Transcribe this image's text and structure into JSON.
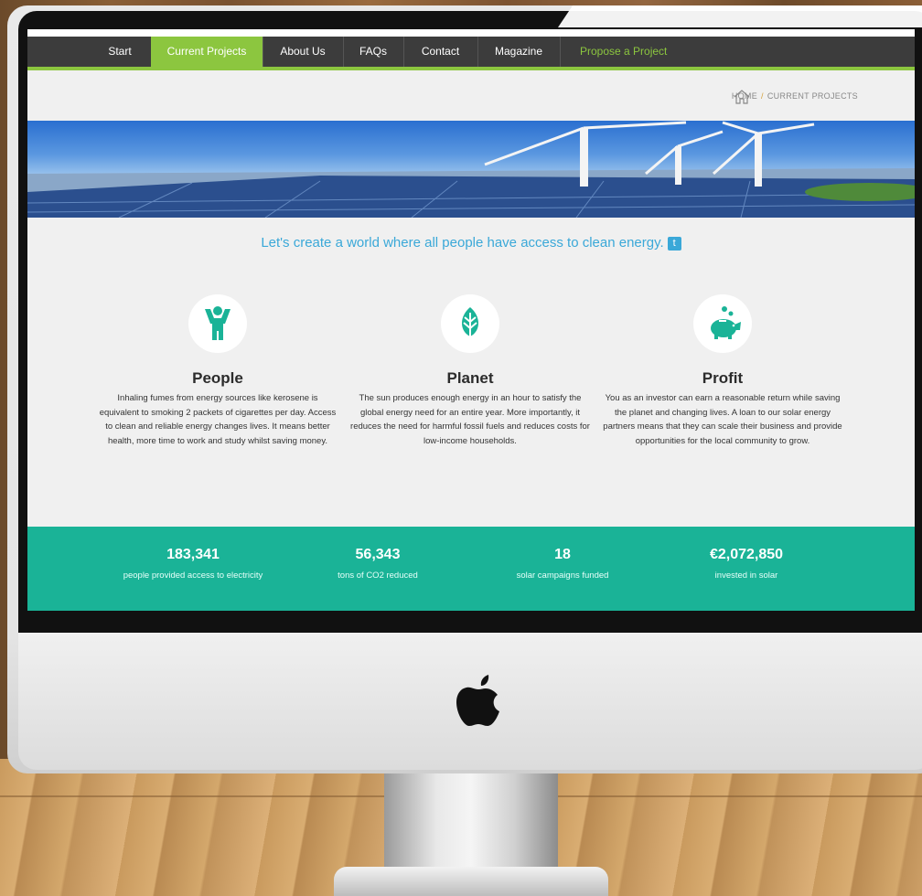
{
  "nav": {
    "items": [
      "Start",
      "Current Projects",
      "About Us",
      "FAQs",
      "Contact",
      "Magazine",
      "Propose a Project"
    ],
    "active": "Current Projects"
  },
  "breadcrumb": {
    "home": "HOME",
    "current": "CURRENT PROJECTS",
    "separator": "/"
  },
  "tagline": "Let's create a world where all people have access to clean energy.",
  "features": [
    {
      "title": "People",
      "icon": "person-icon",
      "text": "Inhaling fumes from energy sources like kerosene is equivalent to smoking 2 packets of cigarettes per day. Access to clean and reliable energy changes lives. It means better health, more time to work and study whilst saving money."
    },
    {
      "title": "Planet",
      "icon": "leaf-icon",
      "text": "The sun produces enough energy in an hour to satisfy the global energy need for an entire year. More importantly, it reduces the need for harmful fossil fuels and reduces costs for low-income households."
    },
    {
      "title": "Profit",
      "icon": "piggy-bank-icon",
      "text": "You as an investor can earn a reasonable return while saving the planet and changing lives. A loan to our solar energy partners means that they can scale their business and provide opportunities for the local community to grow."
    }
  ],
  "stats": [
    {
      "value": "183,341",
      "label": "people provided access to electricity"
    },
    {
      "value": "56,343",
      "label": "tons of CO2 reduced"
    },
    {
      "value": "18",
      "label": "solar campaigns funded"
    },
    {
      "value": "€2,072,850",
      "label": "invested in solar"
    }
  ],
  "colors": {
    "accent": "#8cc63f",
    "teal": "#1ab397",
    "nav": "#3c3c3c",
    "tagline": "#3aa8d8"
  }
}
